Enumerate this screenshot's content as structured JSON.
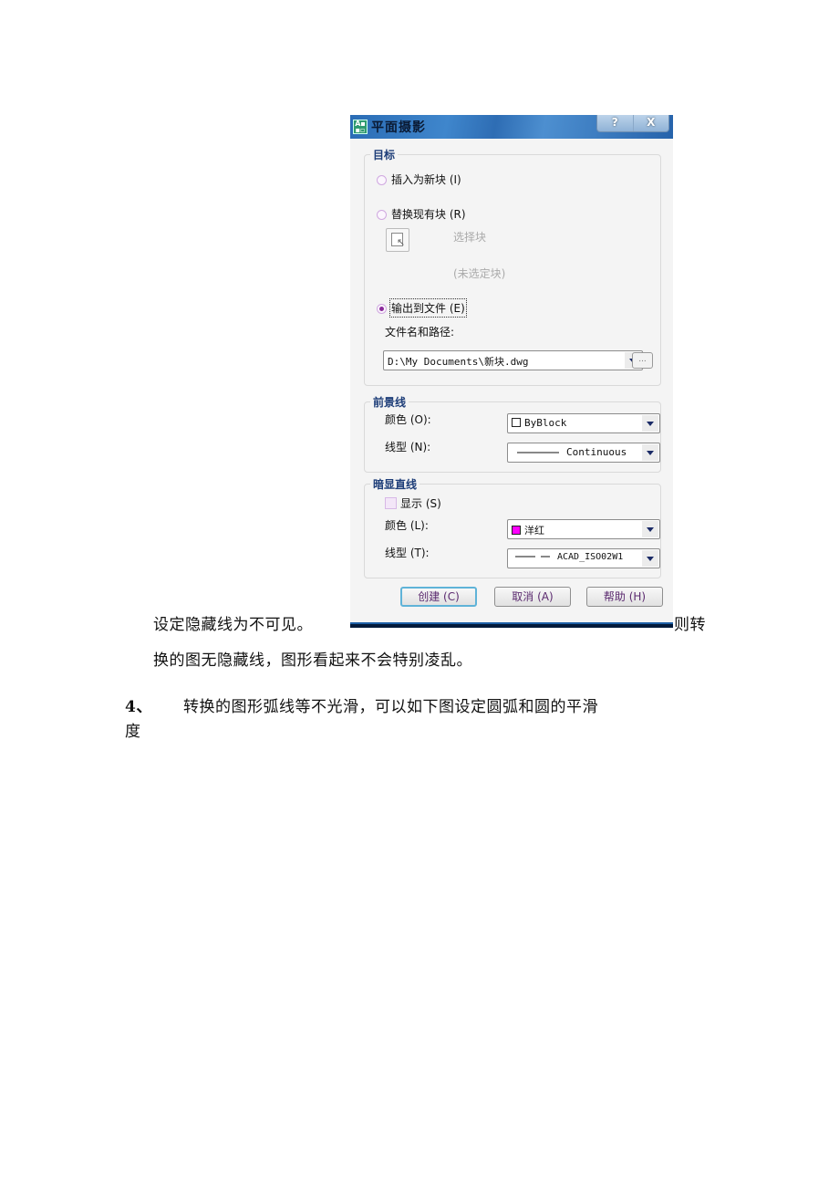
{
  "dialog": {
    "title": "平面摄影",
    "app_icon": "autocad-app-icon",
    "title_buttons": {
      "help": "?",
      "close": "X"
    },
    "target_group": {
      "title": "目标",
      "insert_new_block": "插入为新块 (I)",
      "replace_existing_block": "替换现有块 (R)",
      "select_block": "选择块",
      "no_block_selected": "(未选定块)",
      "export_to_file": "输出到文件 (E)",
      "file_path_label": "文件名和路径:",
      "file_path_value": "D:\\My Documents\\新块.dwg",
      "browse_label": "...",
      "selected_option": "export_to_file"
    },
    "foreground_group": {
      "title": "前景线",
      "color_label": "颜色 (O):",
      "color_value": "ByBlock",
      "color_swatch": "#ffffff",
      "linetype_label": "线型 (N):",
      "linetype_value": "Continuous"
    },
    "obscured_group": {
      "title": "暗显直线",
      "show_label": "显示 (S)",
      "show_checked": false,
      "color_label": "颜色 (L):",
      "color_value": "洋红",
      "color_swatch": "#ff00ff",
      "linetype_label": "线型 (T):",
      "linetype_value": "ACAD_ISO02W1"
    },
    "buttons": {
      "create": "创建 (C)",
      "cancel": "取消 (A)",
      "help": "帮助 (H)"
    }
  },
  "document": {
    "line1_before": "设定隐藏线为不可见。",
    "line1_after": "则转",
    "line2": "换的图无隐藏线，图形看起来不会特别凌乱。",
    "item4_number": "4、",
    "item4_text": "转换的图形弧线等不光滑，可以如下图设定圆弧和圆的平滑",
    "item4_wrap": "度"
  }
}
